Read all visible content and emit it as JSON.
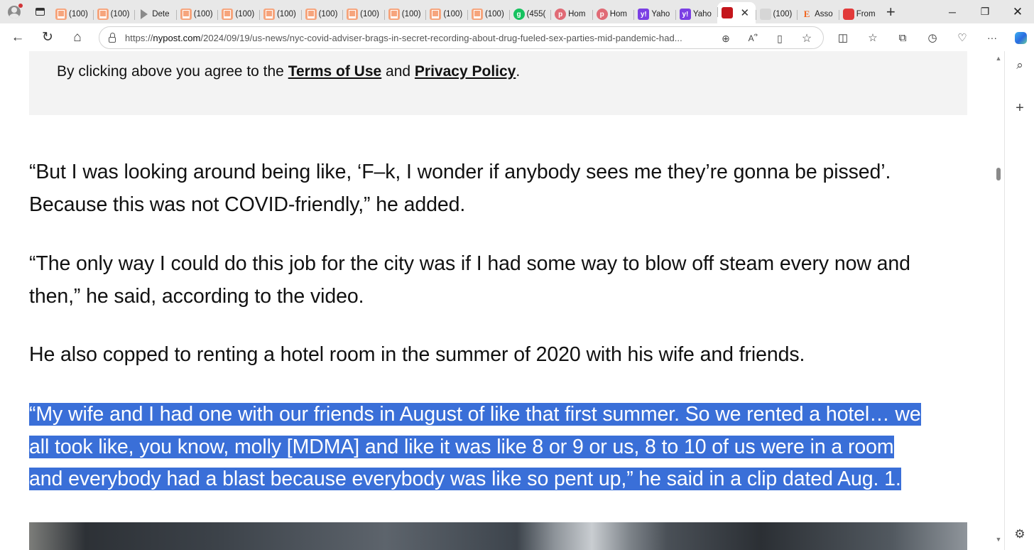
{
  "tabs": [
    {
      "label": "(100)",
      "icon": "substack-icon"
    },
    {
      "label": "(100)",
      "icon": "substack-icon"
    },
    {
      "label": "Dete",
      "icon": "arrow-icon"
    },
    {
      "label": "(100)",
      "icon": "substack-icon"
    },
    {
      "label": "(100)",
      "icon": "substack-icon"
    },
    {
      "label": "(100)",
      "icon": "substack-icon"
    },
    {
      "label": "(100)",
      "icon": "substack-icon"
    },
    {
      "label": "(100)",
      "icon": "substack-icon"
    },
    {
      "label": "(100)",
      "icon": "substack-icon"
    },
    {
      "label": "(100)",
      "icon": "substack-icon"
    },
    {
      "label": "(100)",
      "icon": "substack-icon"
    },
    {
      "label": "(455(",
      "icon": "grammarly-icon"
    },
    {
      "label": "Hom",
      "icon": "pinterest-icon"
    },
    {
      "label": "Hom",
      "icon": "pinterest-icon"
    },
    {
      "label": "Yaho",
      "icon": "yahoo-icon"
    },
    {
      "label": "Yaho",
      "icon": "yahoo-icon"
    },
    {
      "label": "",
      "icon": "nypost-icon",
      "active": true
    },
    {
      "label": "(100)",
      "icon": "blank-icon"
    },
    {
      "label": "Asso",
      "icon": "etsy-icon"
    },
    {
      "label": "From",
      "icon": "youtube-icon"
    }
  ],
  "address": {
    "url_prefix": "https://",
    "url_domain": "nypost.com",
    "url_path": "/2024/09/19/us-news/nyc-covid-adviser-brags-in-secret-recording-about-drug-fueled-sex-parties-mid-pandemic-had..."
  },
  "consent": {
    "prefix": "By clicking above you agree to the ",
    "terms": "Terms of Use",
    "and": " and ",
    "privacy": "Privacy Policy",
    "suffix": "."
  },
  "article": {
    "p1_line1": "“But I was looking around being like, ‘F–k, I wonder if anybody sees me they’re gonna be pissed’.",
    "p1_line2": "Because this was not COVID-friendly,” he added.",
    "p2_line1": "“The only way I could do this job for the city was if I had some way to blow off steam every now and",
    "p2_line2": "then,” he said, according to the video.",
    "p3_line1": "He also copped to renting a hotel room in the summer of 2020 with his wife and friends.",
    "p4_line1": "“My wife and I had one with our friends in August of like that first summer. So we rented a hotel… we",
    "p4_line2": "all took like, you know, molly [MDMA] and like it was like 8 or 9 or us, 8 to 10 of us were in a room",
    "p4_line3": "and everybody had a blast because everybody was like so pent up,” he said in a clip dated Aug. 1."
  },
  "colors": {
    "selection": "#3a6fd8",
    "consent_bg": "#f3f3f3"
  }
}
